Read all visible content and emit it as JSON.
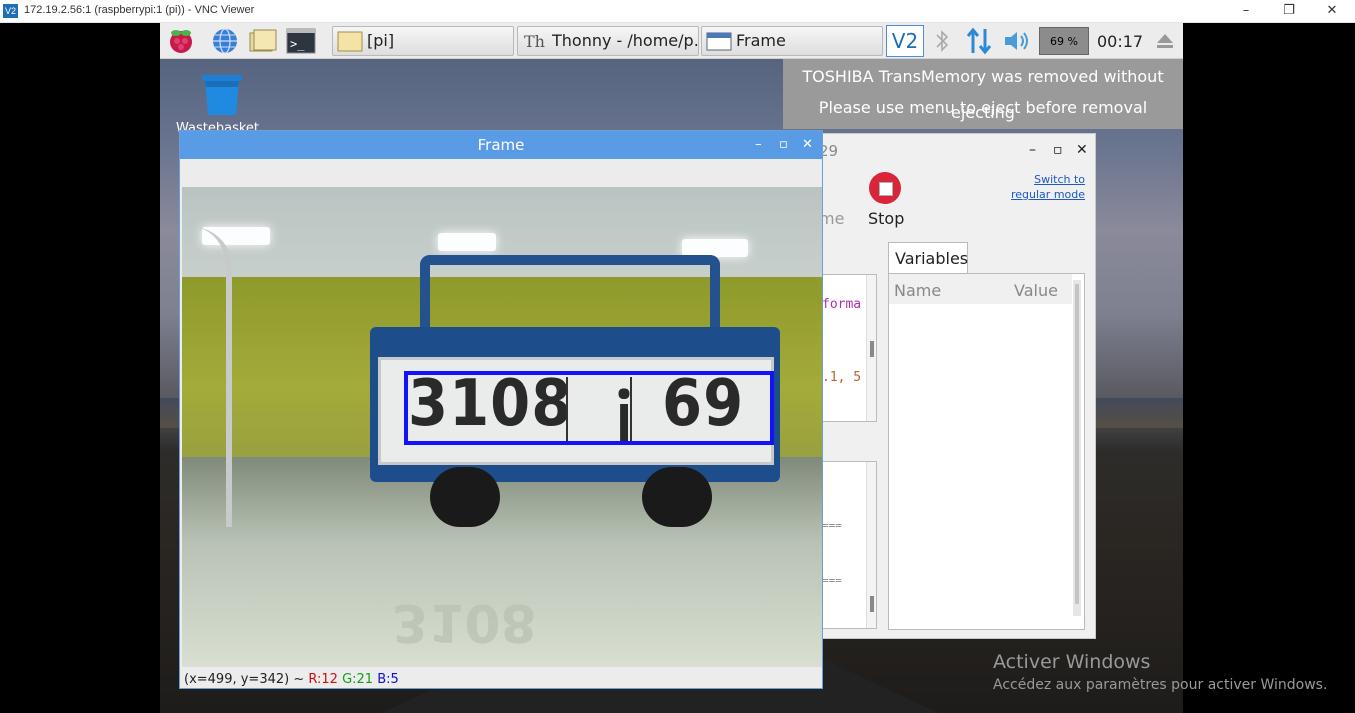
{
  "vnc": {
    "title": "172.19.2.56:1 (raspberrypi:1 (pi)) - VNC Viewer",
    "logo": "V2",
    "minimize": "–",
    "restore": "❐",
    "close": "✕"
  },
  "taskbar": {
    "tasks": [
      {
        "label": "[pi]"
      },
      {
        "label": "Thonny  -  /home/p..."
      },
      {
        "label": "Frame"
      }
    ],
    "tray": {
      "vnc_label": "V2",
      "cpu": "69 %",
      "clock": "00:17"
    }
  },
  "notification": {
    "line1": "TOSHIBA TransMemory was removed without ejecting",
    "line2": "Please use menu to eject before removal"
  },
  "desktop": {
    "wastebasket_label": "Wastebasket"
  },
  "thonny": {
    "title_fragment": "29",
    "resume_fragment": "me",
    "stop_label": "Stop",
    "switch_line1": "Switch to",
    "switch_line2": "regular mode",
    "tab_variables": "Variables",
    "col_name": "Name",
    "col_value": "Value",
    "code_1": "forma",
    "code_2": ".1, 5",
    "shell_1": "===",
    "shell_2": "==="
  },
  "frame": {
    "title": "Frame",
    "plate_left": "3108",
    "plate_mid": "ｉ",
    "plate_right": "69",
    "status_prefix": "(x=499, y=342) ~",
    "status_r": "R:12",
    "status_g": "G:21",
    "status_b": "B:5"
  },
  "watermark": {
    "line1": "Activer Windows",
    "line2": "Accédez aux paramètres pour activer Windows."
  },
  "colors": {
    "titlebar_blue": "#5a9be6",
    "stop_red": "#d9253a",
    "detection_box": "#1212ff"
  }
}
